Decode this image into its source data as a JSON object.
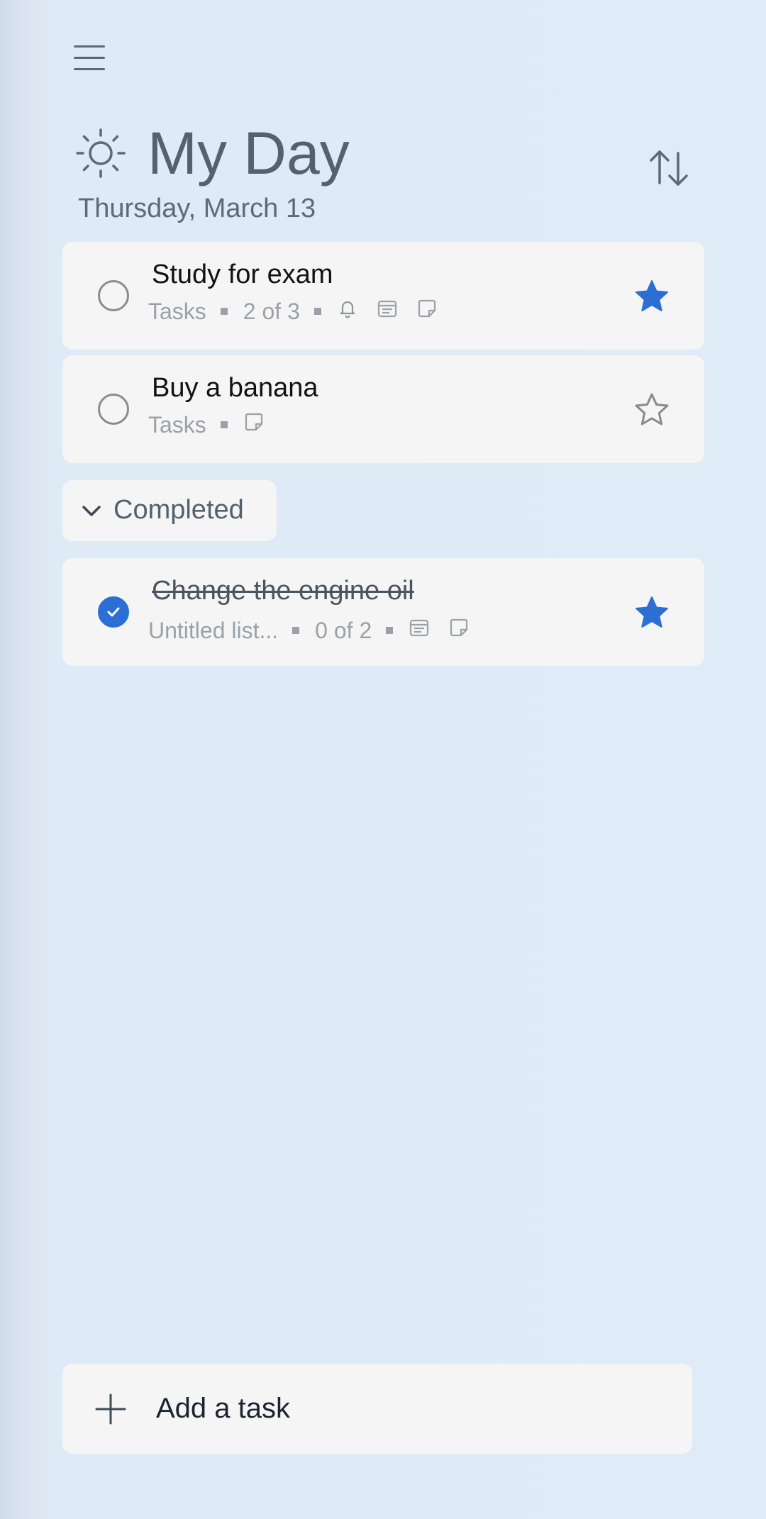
{
  "header": {
    "title": "My Day",
    "date": "Thursday, March 13"
  },
  "tasks": [
    {
      "title": "Study for exam",
      "list": "Tasks",
      "steps": "2 of 3",
      "icons": [
        "bell-icon",
        "calendar-icon",
        "note-icon"
      ],
      "starred": true,
      "completed": false
    },
    {
      "title": "Buy a banana",
      "list": "Tasks",
      "icons": [
        "note-icon"
      ],
      "starred": false,
      "completed": false
    }
  ],
  "completed_section": {
    "label": "Completed",
    "tasks": [
      {
        "title": "Change the engine oil",
        "list": "Untitled list...",
        "steps": "0 of 2",
        "icons": [
          "calendar-icon",
          "note-icon"
        ],
        "starred": true,
        "completed": true
      }
    ]
  },
  "add_task": {
    "label": "Add a task"
  },
  "colors": {
    "background": "#deeaf6",
    "card": "#f5f5f5",
    "accent": "#2b6fd4",
    "title_text": "#54616f",
    "meta_text": "#9aa1a9"
  }
}
